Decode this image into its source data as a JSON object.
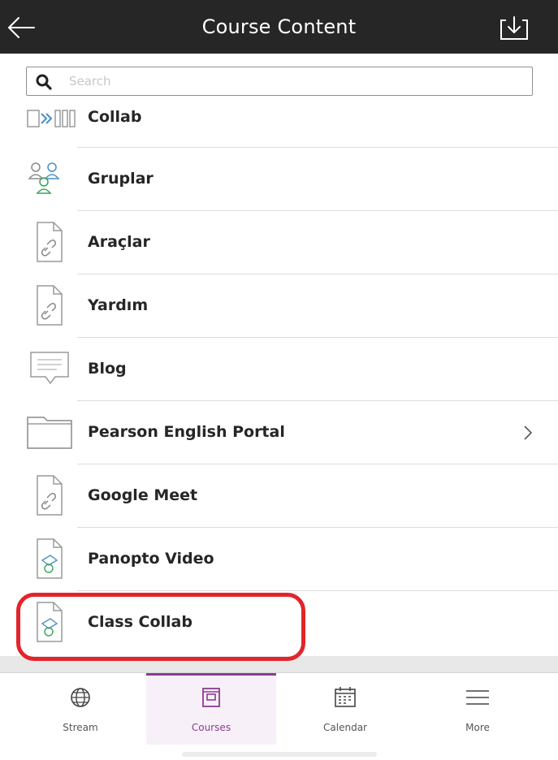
{
  "header": {
    "title": "Course Content",
    "back_icon": "arrow-left-icon",
    "download_icon": "download-icon",
    "background": "#262626"
  },
  "search": {
    "placeholder": "Search",
    "value": ""
  },
  "content_items": [
    {
      "label": "Collab",
      "icon": "collab-icon",
      "has_chevron": false
    },
    {
      "label": "Gruplar",
      "icon": "groups-icon",
      "has_chevron": false
    },
    {
      "label": "Araçlar",
      "icon": "link-document-icon",
      "has_chevron": false
    },
    {
      "label": "Yardım",
      "icon": "link-document-icon",
      "has_chevron": false
    },
    {
      "label": "Blog",
      "icon": "blog-icon",
      "has_chevron": false
    },
    {
      "label": "Pearson English Portal",
      "icon": "folder-icon",
      "has_chevron": true
    },
    {
      "label": "Google Meet",
      "icon": "link-document-icon",
      "has_chevron": false
    },
    {
      "label": "Panopto Video",
      "icon": "tool-document-icon",
      "has_chevron": false
    },
    {
      "label": "Class Collab",
      "icon": "tool-document-icon",
      "has_chevron": false,
      "highlighted": true
    }
  ],
  "tabs": [
    {
      "label": "Stream",
      "icon": "globe-icon",
      "active": false
    },
    {
      "label": "Courses",
      "icon": "courses-icon",
      "active": true
    },
    {
      "label": "Calendar",
      "icon": "calendar-icon",
      "active": false
    },
    {
      "label": "More",
      "icon": "menu-icon",
      "active": false
    }
  ],
  "colors": {
    "accent": "#8a3d8f",
    "highlight_outline": "#e3242b",
    "text": "#262626"
  }
}
